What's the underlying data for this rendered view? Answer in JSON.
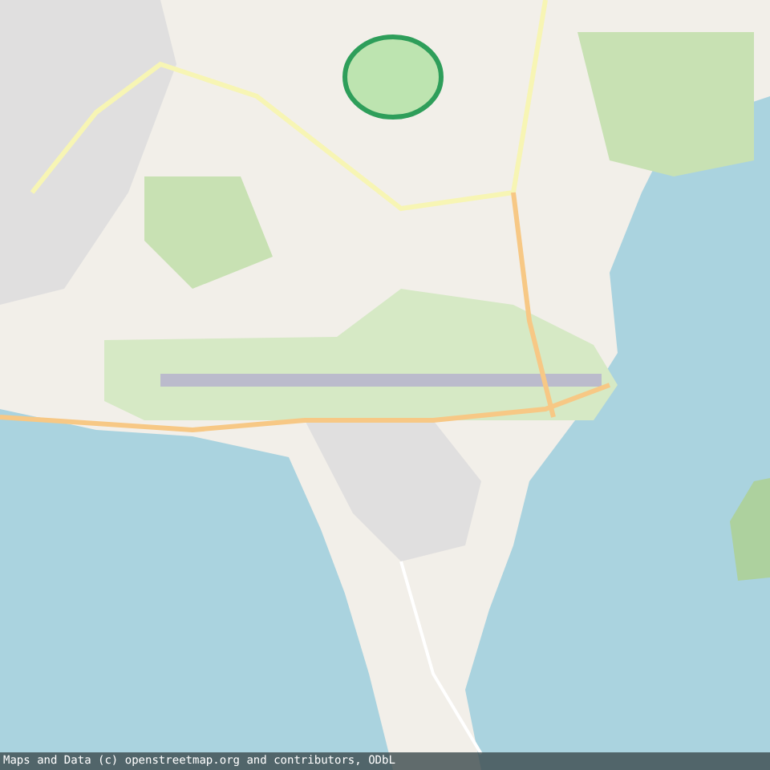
{
  "attribution": "Maps and Data (c) openstreetmap.org and contributors, ODbL"
}
